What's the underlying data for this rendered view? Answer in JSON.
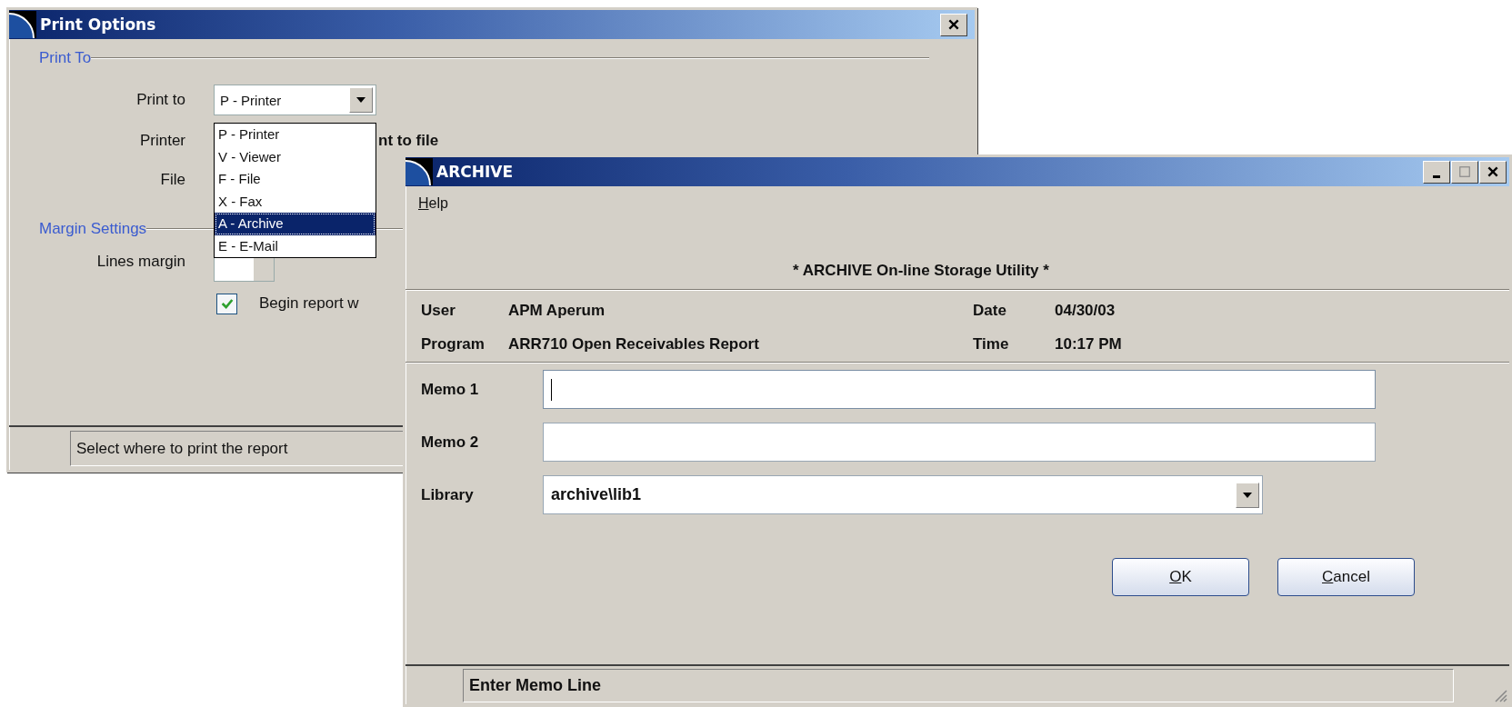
{
  "print_options": {
    "title": "Print Options",
    "section_print_to": "Print To",
    "print_to": {
      "label": "Print to",
      "value": "P - Printer"
    },
    "dropdown_options": [
      {
        "label": "P - Printer",
        "selected": false
      },
      {
        "label": "V - Viewer",
        "selected": false
      },
      {
        "label": "F - File",
        "selected": false
      },
      {
        "label": "X - Fax",
        "selected": false
      },
      {
        "label": "A - Archive",
        "selected": true
      },
      {
        "label": "E - E-Mail",
        "selected": false
      }
    ],
    "printer_label": "Printer",
    "print_to_file_label": "nt to file",
    "file_label": "File",
    "section_margin": "Margin Settings",
    "lines_margin_label": "Lines margin",
    "begin_report": {
      "label": "Begin report w",
      "checked": true
    },
    "status": "Select where to print the report"
  },
  "archive": {
    "title": "ARCHIVE",
    "menu": [
      {
        "label": "Help"
      }
    ],
    "heading": "* ARCHIVE On-line Storage Utility *",
    "info_left": [
      {
        "label": "User",
        "value": "APM Aperum"
      },
      {
        "label": "Program",
        "value": "ARR710 Open Receivables Report"
      }
    ],
    "info_right": [
      {
        "label": "Date",
        "value": "04/30/03"
      },
      {
        "label": "Time",
        "value": "10:17 PM"
      }
    ],
    "fields": [
      {
        "label": "Memo 1",
        "focused": true
      },
      {
        "label": "Memo 2",
        "focused": false
      }
    ],
    "library": {
      "label": "Library",
      "value": "archive\\lib1"
    },
    "buttons": [
      {
        "label": "OK"
      },
      {
        "label": "Cancel"
      }
    ],
    "status": "Enter Memo Line"
  }
}
